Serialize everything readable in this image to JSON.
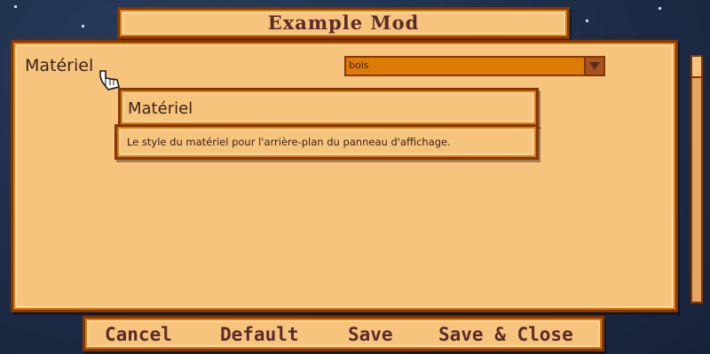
{
  "title": "Example Mod",
  "option": {
    "label": "Matériel",
    "dropdown_value": "bois"
  },
  "tooltip": {
    "title": "Matériel",
    "description": "Le style du matériel pour l'arrière-plan du panneau d'affichage."
  },
  "buttons": {
    "cancel": "Cancel",
    "default": "Default",
    "save": "Save",
    "save_close": "Save & Close"
  },
  "icons": {
    "cursor": "hand-pointer-icon",
    "dropdown_arrow": "chevron-down-icon"
  },
  "colors": {
    "panel": "#f7c47d",
    "border": "#853605",
    "dropdown": "#dc7b05",
    "text": "#5b2b2a"
  }
}
